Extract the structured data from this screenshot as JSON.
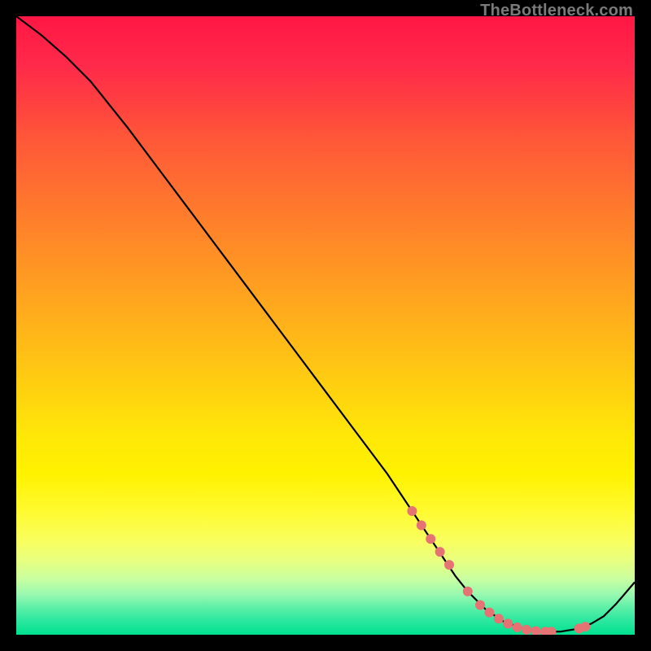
{
  "watermark": "TheBottleneck.com",
  "colors": {
    "background": "#000000",
    "curve": "#000000",
    "points": "#e57373",
    "gradient_top": "#ff1744",
    "gradient_mid": "#fff200",
    "gradient_bottom": "#00e090"
  },
  "chart_data": {
    "type": "line",
    "title": "",
    "xlabel": "",
    "ylabel": "",
    "xlim": [
      0,
      100
    ],
    "ylim": [
      0,
      100
    ],
    "grid": false,
    "legend": false,
    "series": [
      {
        "name": "bottleneck-curve",
        "x": [
          0,
          4,
          8,
          12,
          18,
          24,
          30,
          36,
          42,
          48,
          54,
          60,
          64,
          68,
          71,
          73,
          76,
          79,
          82,
          85,
          88,
          91,
          93,
          95,
          97,
          100
        ],
        "y": [
          100,
          97,
          93.5,
          89.5,
          82,
          74,
          66,
          58,
          50,
          42,
          34,
          26,
          20,
          14,
          9.5,
          7,
          4,
          2,
          1,
          0.5,
          0.5,
          1,
          1.8,
          3,
          5,
          8.5
        ]
      }
    ],
    "highlight_points": {
      "name": "marked-points",
      "x": [
        64,
        65.5,
        67,
        68.5,
        70,
        73,
        75,
        76.5,
        78,
        79.5,
        81,
        82.5,
        84,
        85.5,
        86.5,
        91,
        92
      ],
      "y": [
        20,
        17.7,
        15.5,
        13.4,
        11.3,
        7,
        4.8,
        3.6,
        2.6,
        1.8,
        1.2,
        0.8,
        0.6,
        0.5,
        0.5,
        1,
        1.3
      ]
    }
  }
}
